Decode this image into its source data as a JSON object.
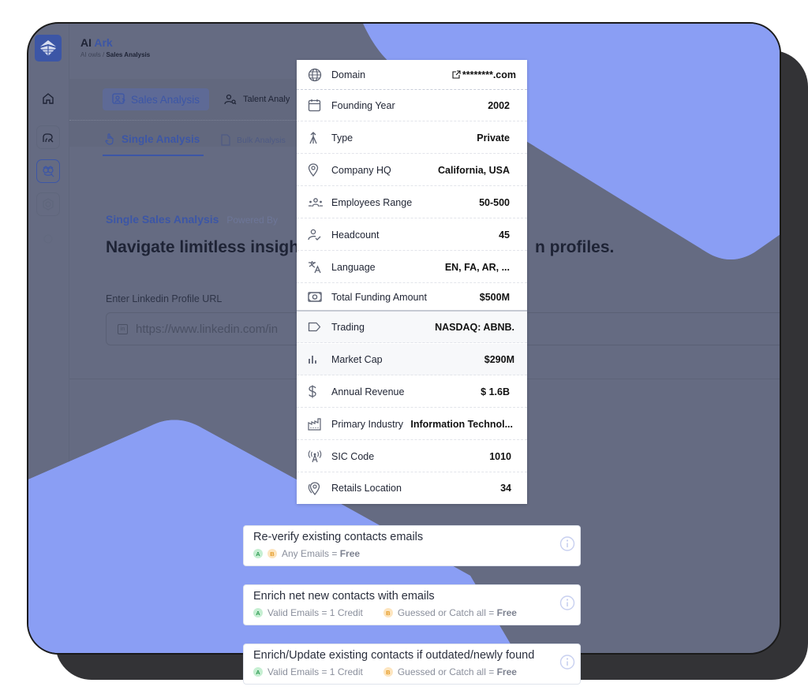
{
  "app": {
    "title_part1": "AI",
    "title_part2": "Ark",
    "breadcrumb_parent": "AI owls",
    "breadcrumb_sep": " / ",
    "breadcrumb_current": "Sales Analysis"
  },
  "sidebar": {
    "items": [
      {
        "name": "home",
        "icon": "home-icon"
      },
      {
        "name": "people-search",
        "icon": "people-search-icon"
      },
      {
        "name": "owl-analysis",
        "icon": "owl-icon",
        "active": true
      },
      {
        "name": "hexagon",
        "icon": "hexagon-icon"
      },
      {
        "name": "edit",
        "icon": "edit-icon"
      }
    ]
  },
  "tabs": [
    {
      "label": "Sales Analysis",
      "icon": "sales-icon",
      "active": true
    },
    {
      "label": "Talent Analy",
      "icon": "talent-search-icon",
      "active": false
    }
  ],
  "subtabs": [
    {
      "label": "Single Analysis",
      "icon": "touch-icon",
      "active": true
    },
    {
      "label": "Bulk Analysis",
      "icon": "file-icon",
      "active": false
    }
  ],
  "main": {
    "section_title": "Single Sales Analysis",
    "powered_by": "Powered By",
    "headline_left": "Navigate limitless insigh",
    "headline_right": "n profiles.",
    "url_label": "Enter Linkedin Profile URL",
    "url_placeholder": "https://www.linkedin.com/in"
  },
  "company_panel": {
    "rows": [
      {
        "label": "Domain",
        "value": "********.com",
        "icon": "globe-icon"
      },
      {
        "label": "Founding Year",
        "value": "2002",
        "icon": "calendar-icon"
      },
      {
        "label": "Type",
        "value": "Private",
        "icon": "merge-icon"
      },
      {
        "label": "Company HQ",
        "value": "California, USA",
        "icon": "location-pin-icon"
      },
      {
        "label": "Employees Range",
        "value": "50-500",
        "icon": "group-icon"
      },
      {
        "label": "Headcount",
        "value": "45",
        "icon": "user-check-icon"
      },
      {
        "label": "Language",
        "value": "EN, FA, AR, ...",
        "icon": "translate-icon"
      },
      {
        "label": "Total Funding Amount",
        "value": "$500M",
        "icon": "money-icon"
      },
      {
        "label": "Trading",
        "value": "NASDAQ: ABNB.",
        "icon": "tag-icon"
      },
      {
        "label": "Market Cap",
        "value": "$290M",
        "icon": "bar-chart-icon"
      },
      {
        "label": "Annual Revenue",
        "value": "$ 1.6B",
        "icon": "dollar-icon"
      },
      {
        "label": "Primary Industry",
        "value": "Information Technol...",
        "icon": "factory-icon"
      },
      {
        "label": "SIC Code",
        "value": "1010",
        "icon": "antenna-icon"
      },
      {
        "label": "Retails Location",
        "value": "34",
        "icon": "location-multi-icon"
      }
    ]
  },
  "options": [
    {
      "title": "Re-verify existing contacts emails",
      "badge_a": "A",
      "badge_b": "B",
      "text": "Any Emails = ",
      "text_bold": "Free"
    },
    {
      "title": "Enrich net new contacts with emails",
      "badge_a": "A",
      "text_a": "Valid Emails = 1 Credit",
      "badge_b": "B",
      "text_b": "Guessed or Catch all = ",
      "text_b_bold": "Free"
    },
    {
      "title": "Enrich/Update existing contacts if outdated/newly found",
      "badge_a": "A",
      "text_a": "Valid Emails = 1 Credit",
      "badge_b": "B",
      "text_b": "Guessed or Catch all = ",
      "text_b_bold": "Free"
    }
  ],
  "colors": {
    "accent": "#3c56a6",
    "overlay": "#656b82",
    "blob": "#8a9ef4",
    "badge_a": "#2e9a52",
    "badge_b": "#e49a24"
  }
}
